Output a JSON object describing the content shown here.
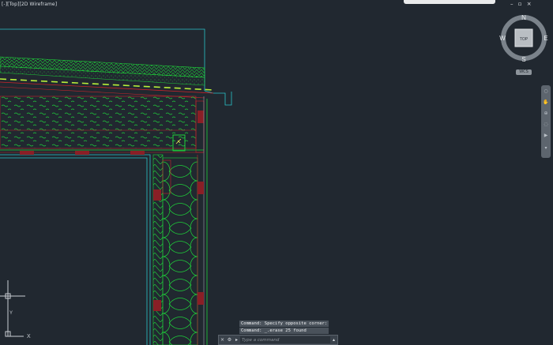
{
  "viewport": {
    "label": "[-][Top][2D Wireframe]"
  },
  "window_controls": {
    "minimize": "–",
    "restore": "▫",
    "close": "×"
  },
  "viewcube": {
    "face": "TOP",
    "north": "N",
    "south": "S",
    "east": "E",
    "west": "W",
    "wcs": "WCS"
  },
  "ucs": {
    "x_label": "X",
    "y_label": "Y"
  },
  "command": {
    "history": [
      "Command: Specify opposite corner:",
      "Command: _.erase 25 found"
    ],
    "placeholder": "Type a command",
    "close_icon": "×",
    "wrench_icon": "⚙",
    "prompt_icon": "▸",
    "scroll_icon": "▴"
  },
  "colors": {
    "background": "#212830",
    "outline_cyan": "#29c4c9",
    "hatch_green": "#1fd13a",
    "red": "#c8242b",
    "dashed_yellowgreen": "#b7f03a"
  }
}
